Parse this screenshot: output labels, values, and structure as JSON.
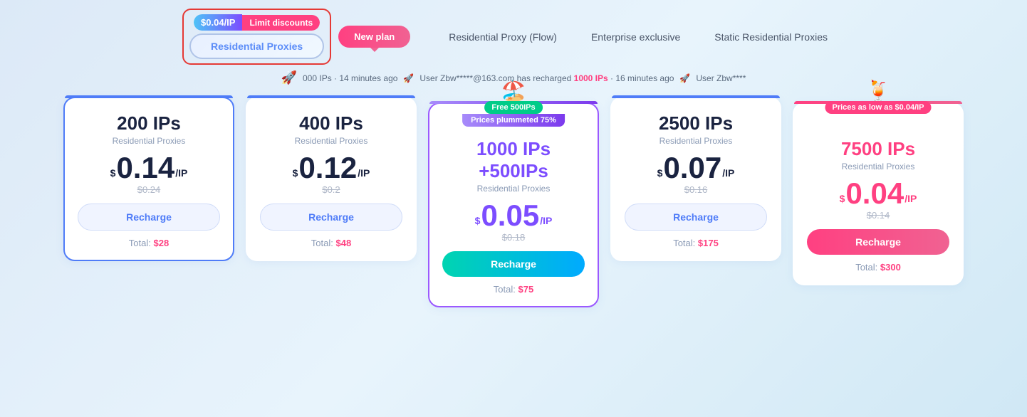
{
  "header": {
    "limit_price": "$0.04/IP",
    "limit_text": "Limit discounts",
    "new_plan_label": "New plan",
    "tab_residential": "Residential Proxies",
    "tab_flow": "Residential Proxy (Flow)",
    "tab_enterprise": "Enterprise exclusive",
    "tab_static": "Static Residential Proxies"
  },
  "ticker": {
    "items": [
      {
        "text": "000 IPs · 14 minutes ago",
        "icon": "🚀"
      },
      {
        "separator": "·"
      },
      {
        "text": "User Zbw*****@163.com has recharged ",
        "highlight": "1000 IPs",
        "suffix": " · 16 minutes ago",
        "icon": "🚀"
      },
      {
        "separator": "·"
      },
      {
        "text": "User Zbw****",
        "icon": "🚀"
      }
    ]
  },
  "plans": [
    {
      "id": "plan-200",
      "ip_count": "200 IPs",
      "type": "Residential Proxies",
      "price_main": "0.14",
      "price_original": "$0.24",
      "total": "$28",
      "btn_label": "Recharge",
      "btn_style": "outline",
      "selected": true,
      "featured": false,
      "banner": null,
      "ip_color": "dark",
      "price_color": "dark"
    },
    {
      "id": "plan-400",
      "ip_count": "400 IPs",
      "type": "Residential Proxies",
      "price_main": "0.12",
      "price_original": "$0.2",
      "total": "$48",
      "btn_label": "Recharge",
      "btn_style": "outline",
      "selected": false,
      "featured": false,
      "banner": null,
      "ip_color": "dark",
      "price_color": "dark"
    },
    {
      "id": "plan-1000",
      "ip_count": "1000 IPs +500IPs",
      "type": "Residential Proxies",
      "price_main": "0.05",
      "price_original": "$0.18",
      "total": "$75",
      "btn_label": "Recharge",
      "btn_style": "gradient-teal",
      "selected": false,
      "featured": true,
      "banner": {
        "emoji": "🏖️",
        "top_tag": "Free 500IPs",
        "top_tag_style": "green",
        "sub_tag": "Prices plummeted 75%",
        "sub_tag_style": "purple"
      },
      "ip_color": "purple",
      "price_color": "purple"
    },
    {
      "id": "plan-2500",
      "ip_count": "2500 IPs",
      "type": "Residential Proxies",
      "price_main": "0.07",
      "price_original": "$0.16",
      "total": "$175",
      "btn_label": "Recharge",
      "btn_style": "outline",
      "selected": false,
      "featured": false,
      "banner": null,
      "ip_color": "dark",
      "price_color": "dark"
    },
    {
      "id": "plan-7500",
      "ip_count": "7500 IPs",
      "type": "Residential Proxies",
      "price_main": "0.04",
      "price_original": "$0.14",
      "total": "$300",
      "btn_label": "Recharge",
      "btn_style": "pink-solid",
      "selected": false,
      "featured": false,
      "banner": {
        "emoji": "🍹",
        "top_tag": "Prices as low as $0.04/IP",
        "top_tag_style": "pink-solid",
        "sub_tag": null
      },
      "ip_color": "pink",
      "price_color": "pink"
    }
  ]
}
